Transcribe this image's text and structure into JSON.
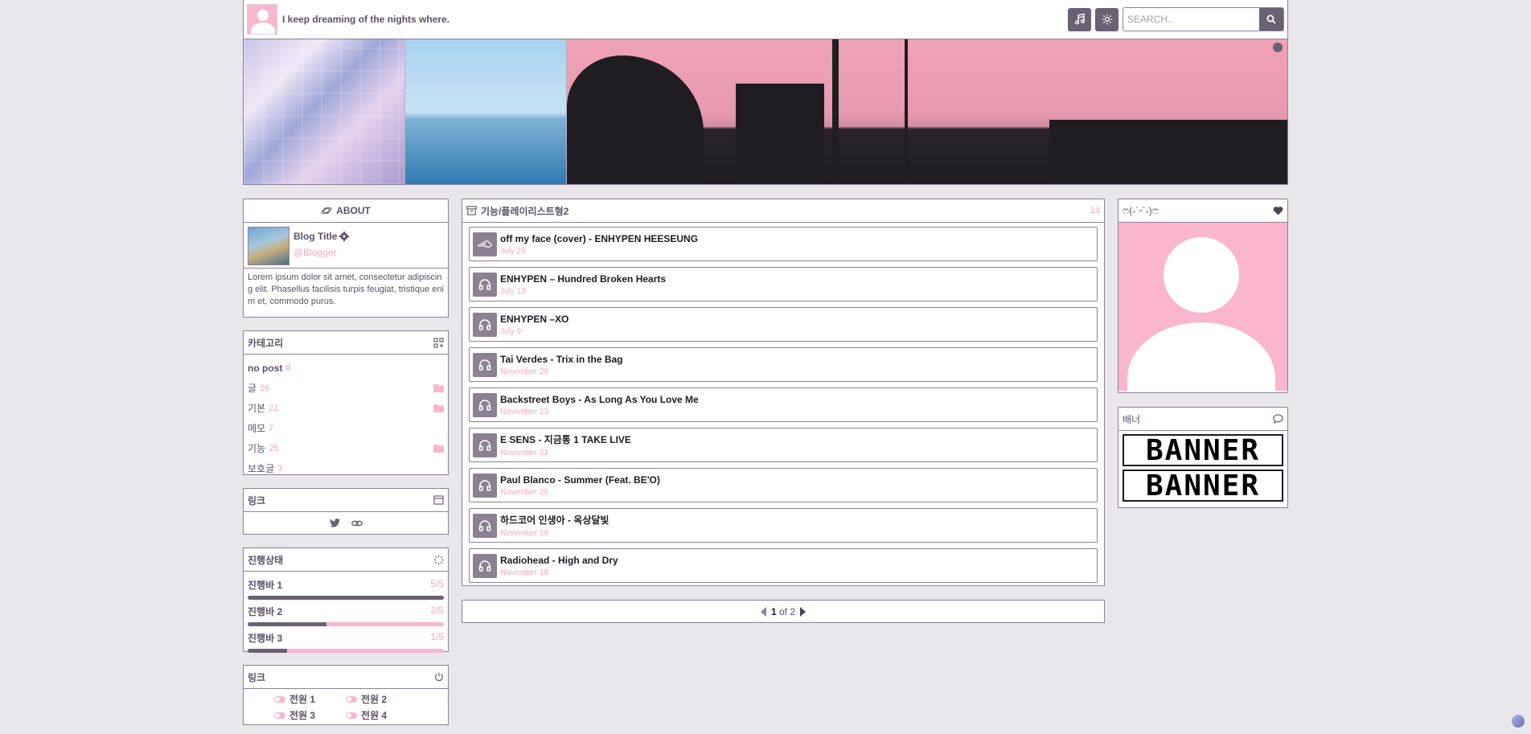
{
  "header": {
    "title": "I keep dreaming of the nights where.",
    "search_placeholder": "SEARCH.."
  },
  "about": {
    "heading": "ABOUT",
    "blog_title": "Blog Title",
    "handle": "@Blogger",
    "description": "Lorem ipsum dolor sit amet, consectetur adipiscing elit. Phasellus facilisis turpis feugiat, tristique enim et, commodo purus."
  },
  "categories": {
    "heading": "카테고리",
    "items": [
      {
        "label": "no post",
        "count": "0"
      },
      {
        "label": "글",
        "count": "26"
      },
      {
        "label": "기본",
        "count": "21"
      },
      {
        "label": "메모",
        "count": "7"
      },
      {
        "label": "기능",
        "count": "25"
      },
      {
        "label": "보호글",
        "count": "3"
      }
    ]
  },
  "links": {
    "heading": "링크"
  },
  "progress": {
    "heading": "진행상태",
    "items": [
      {
        "label": "진행바 1",
        "value": "5/5",
        "fraction": 1.0
      },
      {
        "label": "진행바 2",
        "value": "2/5",
        "fraction": 0.4
      },
      {
        "label": "진행바 3",
        "value": "1/5",
        "fraction": 0.2
      }
    ]
  },
  "power": {
    "heading": "링크",
    "items": [
      "전원 1",
      "전원 2",
      "전원 3",
      "전원 4"
    ]
  },
  "main": {
    "heading": "기능/플레이리스트형2",
    "count": "14",
    "posts": [
      {
        "title": "off my face (cover) - ENHYPEN HEESEUNG",
        "date": "July 25",
        "icon": "soundcloud-icon"
      },
      {
        "title": "ENHYPEN – Hundred Broken Hearts",
        "date": "July 13",
        "icon": "headphones-icon"
      },
      {
        "title": "ENHYPEN –XO",
        "date": "July 9",
        "icon": "headphones-icon"
      },
      {
        "title": "Tai Verdes - Trix in the Bag",
        "date": "November 26",
        "icon": "headphones-icon"
      },
      {
        "title": "Backstreet Boys - As Long As You Love Me",
        "date": "November 23",
        "icon": "headphones-icon"
      },
      {
        "title": "E SENS - 지금통 1 TAKE LIVE",
        "date": "November 21",
        "icon": "headphones-icon"
      },
      {
        "title": "Paul Blanco - Summer (Feat. BE'O)",
        "date": "November 20",
        "icon": "headphones-icon"
      },
      {
        "title": "하드코어 인생아 - 옥상달빛",
        "date": "November 19",
        "icon": "headphones-icon"
      },
      {
        "title": "Radiohead - High and Dry",
        "date": "November 18",
        "icon": "headphones-icon"
      }
    ],
    "pager": {
      "current": "1",
      "of_text": "of 2"
    }
  },
  "profile": {
    "heading": "ෆ(˶ˊᵕˋ˶)ෆ"
  },
  "banner": {
    "heading": "배너",
    "items": [
      "BANNER",
      "BANNER"
    ]
  },
  "colors": {
    "accent": "#f9b6ce",
    "dark": "#6a6173",
    "border": "#8c8298"
  }
}
